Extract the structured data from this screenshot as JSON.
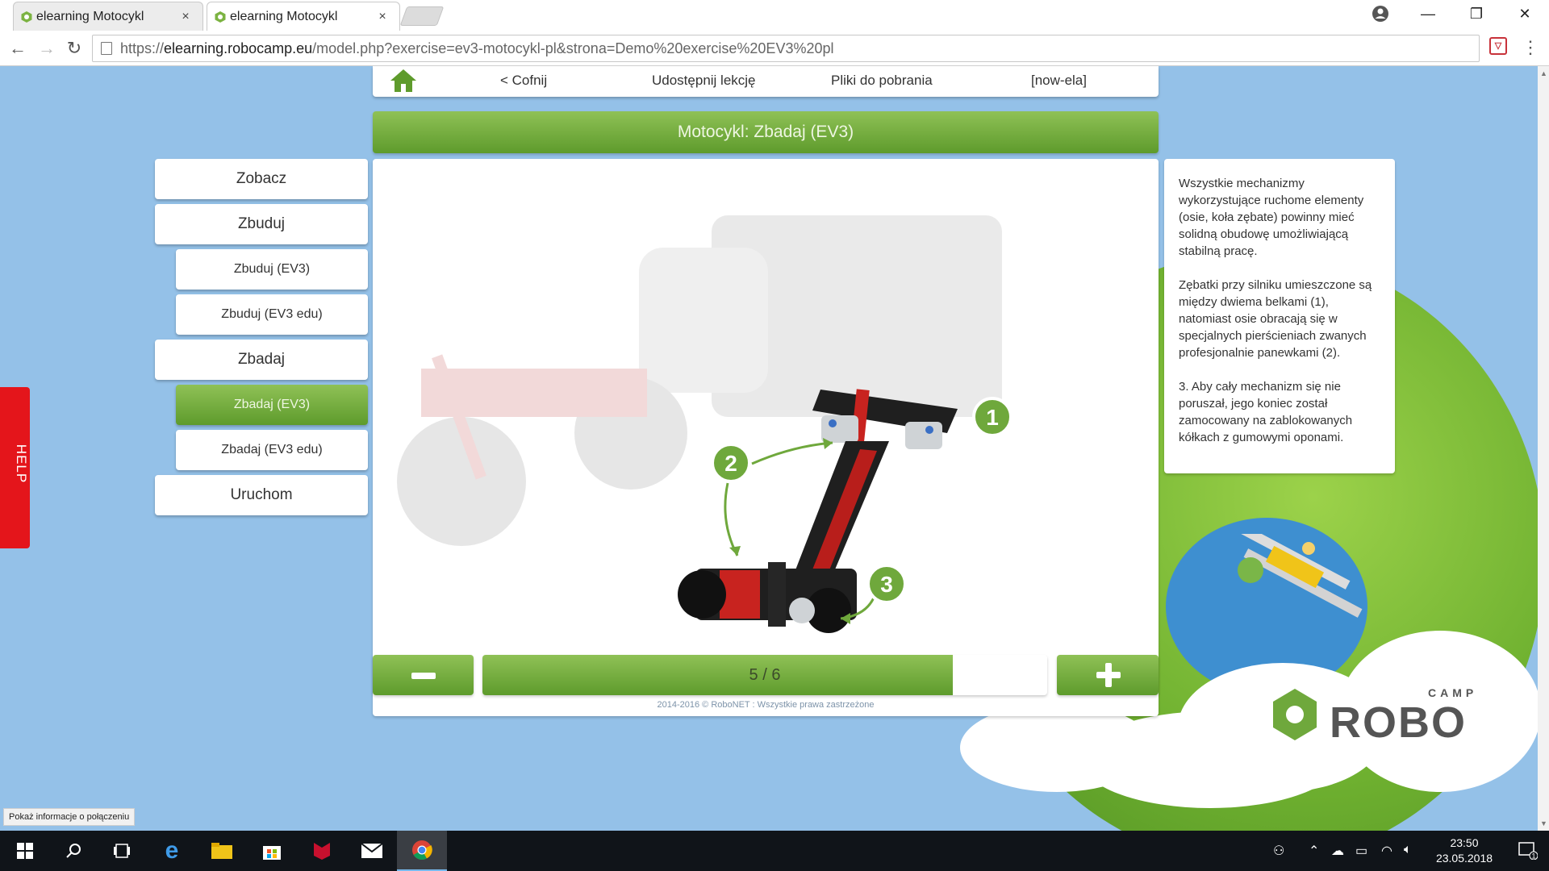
{
  "browser": {
    "tabs": [
      {
        "title": "elearning Motocykl",
        "active": false
      },
      {
        "title": "elearning Motocykl",
        "active": true
      }
    ],
    "tab_close": "×",
    "window_controls": {
      "minimize": "—",
      "maximize": "❐",
      "close": "✕"
    },
    "url_scheme_prefix": "https://",
    "url_host": "elearning.robocamp.eu",
    "url_path": "/model.php?exercise=ev3-motocykl-pl&strona=Demo%20exercise%20EV3%20pl",
    "extension_label": "▽"
  },
  "topnav": {
    "back": "< Cofnij",
    "share": "Udostępnij lekcję",
    "downloads": "Pliki do pobrania",
    "user": "[now-ela]"
  },
  "page_title": "Motocykl: Zbadaj (EV3)",
  "sidebar": {
    "items": [
      {
        "label": "Zobacz",
        "level": "main",
        "active": false
      },
      {
        "label": "Zbuduj",
        "level": "main",
        "active": false
      },
      {
        "label": "Zbuduj (EV3)",
        "level": "sub",
        "active": false
      },
      {
        "label": "Zbuduj (EV3 edu)",
        "level": "sub",
        "active": false
      },
      {
        "label": "Zbadaj",
        "level": "main",
        "active": false
      },
      {
        "label": "Zbadaj (EV3)",
        "level": "sub",
        "active": true
      },
      {
        "label": "Zbadaj (EV3 edu)",
        "level": "sub",
        "active": false
      },
      {
        "label": "Uruchom",
        "level": "main",
        "active": false
      }
    ]
  },
  "callouts": [
    "1",
    "2",
    "3"
  ],
  "info": {
    "p1": "Wszystkie mechanizmy wykorzystujące ruchome elementy (osie, koła zębate) powinny mieć solidną obudowę umożliwiającą stabilną pracę.",
    "p2": "Zębatki przy silniku umieszczone są między dwiema belkami (1), natomiast osie obracają się w specjalnych pierścieniach zwanych profesjonalnie panewkami (2).",
    "p3": "3. Aby cały mechanizm się nie poruszał, jego koniec został zamocowany na zablokowanych kółkach z gumowymi oponami."
  },
  "pager": {
    "label": "5 / 6",
    "current": 5,
    "total": 6
  },
  "copyright": "2014-2016 © RoboNET : Wszystkie prawa zastrzeżone",
  "help_label": "HELP",
  "status_tooltip": "Pokaż informacje o połączeniu",
  "logo": {
    "small": "CAMP",
    "big": "ROBO"
  },
  "taskbar": {
    "time": "23:50",
    "date": "23.05.2018",
    "notification_count": "1"
  },
  "colors": {
    "accent_green": "#6fa83c",
    "sky": "#94c1e8",
    "help_red": "#e4151b"
  }
}
